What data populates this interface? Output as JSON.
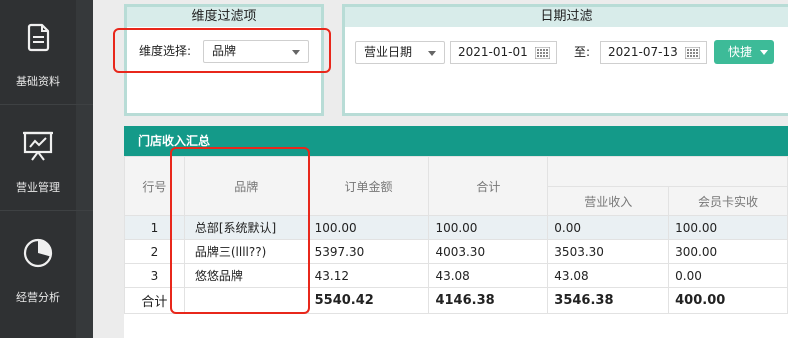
{
  "sidebar": {
    "items": [
      {
        "label": "基础资料",
        "icon": "document-icon"
      },
      {
        "label": "营业管理",
        "icon": "presentation-icon"
      },
      {
        "label": "经营分析",
        "icon": "pie-chart-icon"
      }
    ]
  },
  "dimension_filter": {
    "title": "维度过滤项",
    "label": "维度选择:",
    "selected": "品牌"
  },
  "date_filter": {
    "title": "日期过滤",
    "date_type": "营业日期",
    "start_date": "2021-01-01",
    "to_label": "至:",
    "end_date": "2021-07-13",
    "quick_label": "快捷"
  },
  "summary_table": {
    "title": "门店收入汇总",
    "headers": {
      "row_no": "行号",
      "brand": "品牌",
      "order_amount": "订单金额",
      "total": "合计",
      "business_income": "营业收入",
      "member_card": "会员卡实收"
    },
    "rows": [
      {
        "no": "1",
        "brand": "总部[系统默认]",
        "order_amount": "100.00",
        "total": "100.00",
        "business_income": "0.00",
        "member_card": "100.00"
      },
      {
        "no": "2",
        "brand": "品牌三(llll??)",
        "order_amount": "5397.30",
        "total": "4003.30",
        "business_income": "3503.30",
        "member_card": "300.00"
      },
      {
        "no": "3",
        "brand": "悠悠品牌",
        "order_amount": "43.12",
        "total": "43.08",
        "business_income": "43.08",
        "member_card": "0.00"
      }
    ],
    "totals": {
      "label": "合计",
      "order_amount": "5540.42",
      "total": "4146.38",
      "business_income": "3546.38",
      "member_card": "400.00"
    }
  },
  "colors": {
    "sidebar_bg": "#2f3133",
    "accent_teal": "#149a89",
    "quick_button": "#3dbb98",
    "highlight_red": "#e8271b"
  }
}
